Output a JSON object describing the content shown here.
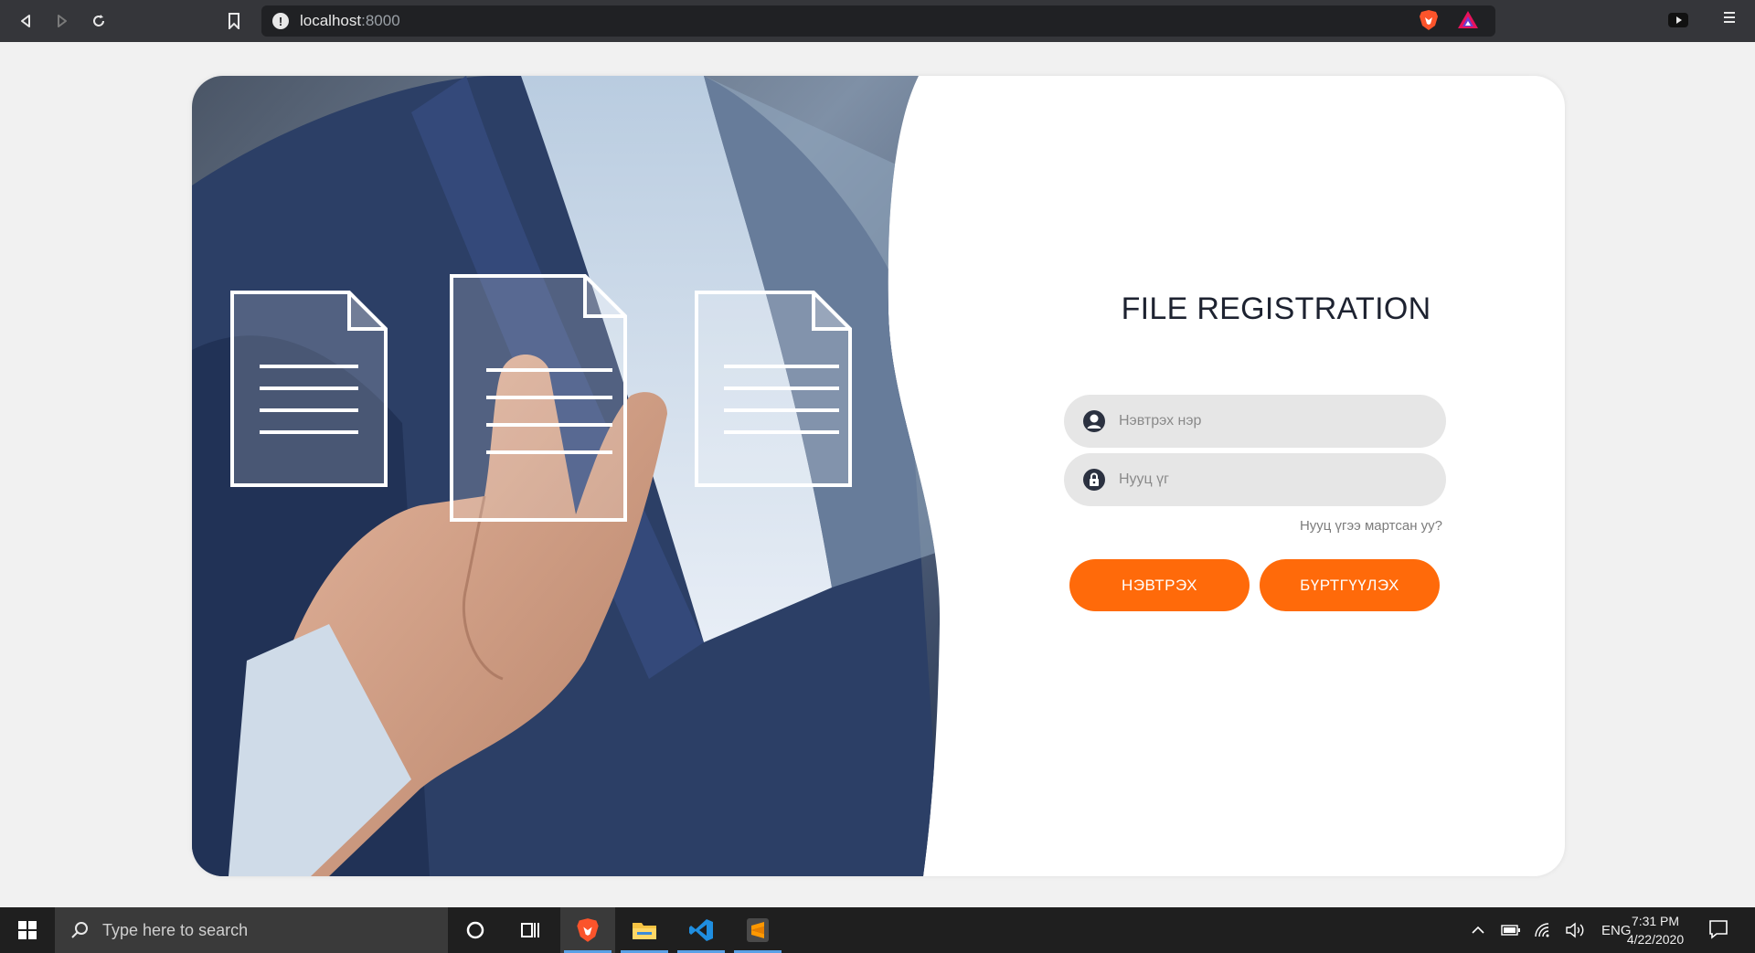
{
  "browser": {
    "url_host": "localhost",
    "url_port": ":8000",
    "icons": [
      "back-icon",
      "forward-icon",
      "reload-icon",
      "bookmark-icon",
      "info-icon",
      "brave-shield-icon",
      "brave-rewards-icon",
      "youtube-icon",
      "menu-icon"
    ]
  },
  "login": {
    "title": "FILE REGISTRATION",
    "username_placeholder": "Нэвтрэх нэр",
    "password_placeholder": "Нууц үг",
    "forgot_password": "Нууц үгээ мартсан уу?",
    "login_button": "НЭВТРЭХ",
    "register_button": "БҮРТГҮҮЛЭХ",
    "accent_color": "#ff6a0a"
  },
  "taskbar": {
    "search_placeholder": "Type here to search",
    "language": "ENG",
    "time": "7:31 PM",
    "date": "4/22/2020",
    "apps": [
      "brave-icon",
      "file-explorer-icon",
      "vscode-icon",
      "sublime-icon"
    ]
  }
}
